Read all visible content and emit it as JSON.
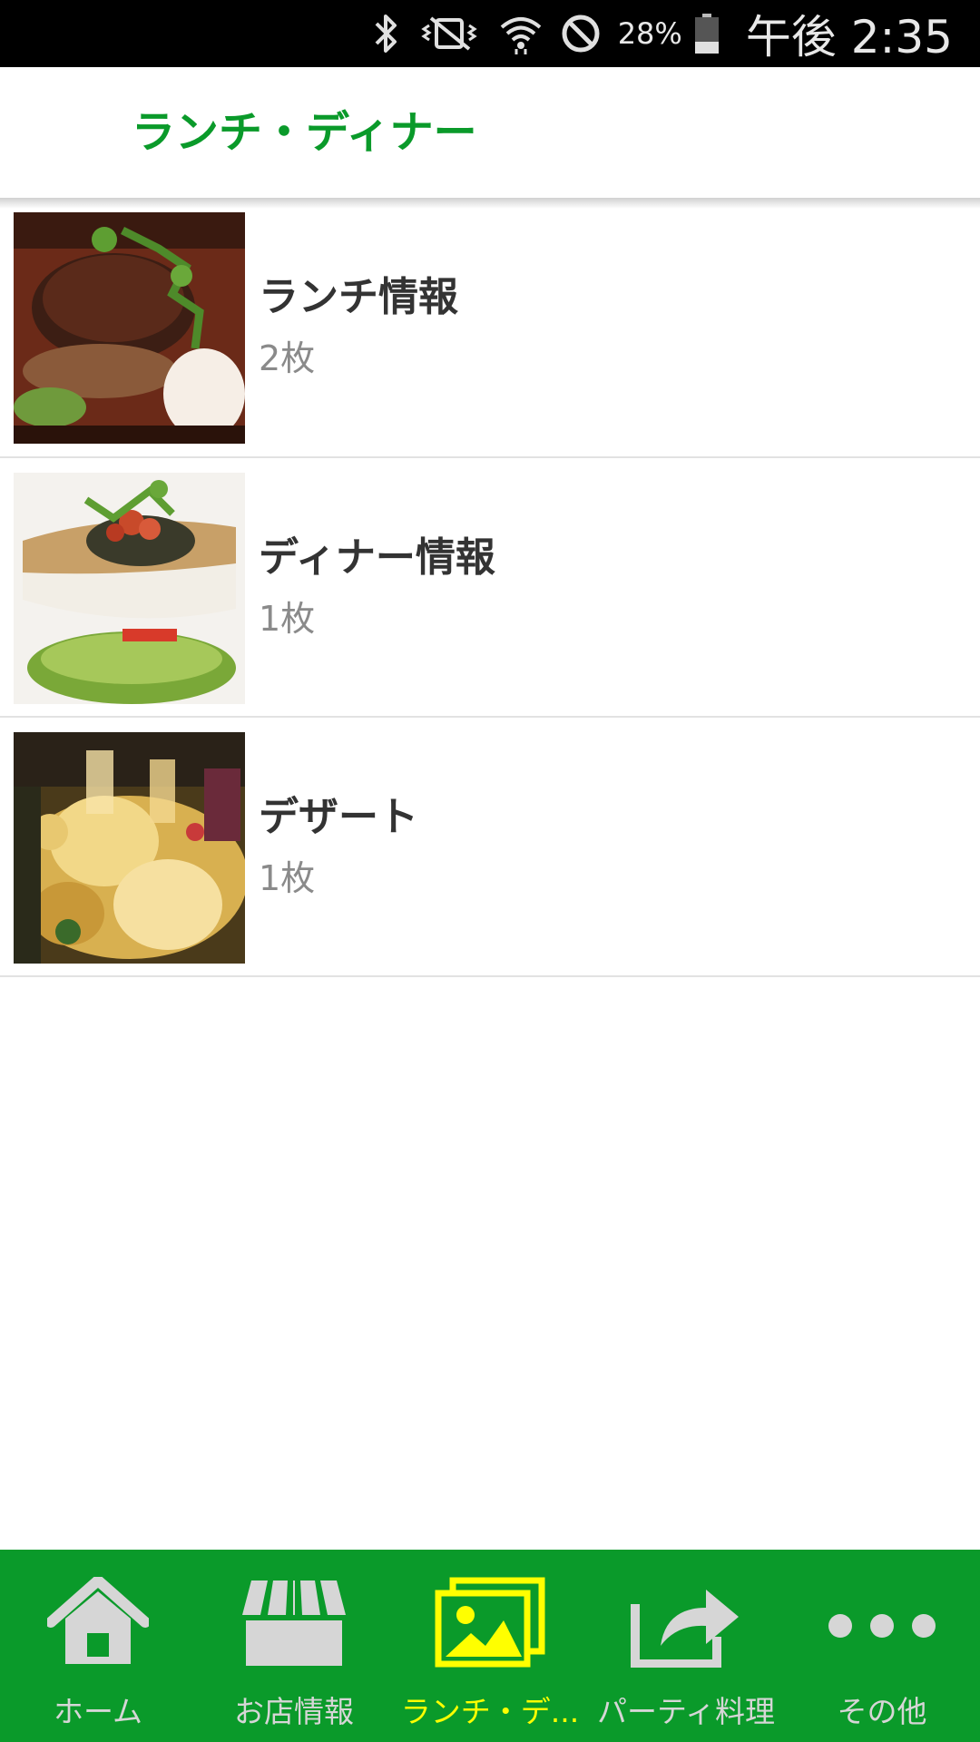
{
  "status_bar": {
    "battery": "28%",
    "time": "午後 2:35",
    "icons": [
      "bluetooth-icon",
      "vibrate-icon",
      "wifi-icon",
      "do-not-disturb-icon",
      "battery-icon"
    ]
  },
  "app_bar": {
    "title": "ランチ・ディナー"
  },
  "list": {
    "items": [
      {
        "title": "ランチ情報",
        "count": "2枚",
        "image": "hamburg-steak-photo"
      },
      {
        "title": "ディナー情報",
        "count": "1枚",
        "image": "fish-dish-photo"
      },
      {
        "title": "デザート",
        "count": "1枚",
        "image": "party-drinks-photo"
      }
    ]
  },
  "bottom_nav": {
    "tabs": [
      {
        "label": "ホーム",
        "icon": "home-icon",
        "active": false
      },
      {
        "label": "お店情報",
        "icon": "store-icon",
        "active": false
      },
      {
        "label": "ランチ・デ...",
        "icon": "gallery-icon",
        "active": true
      },
      {
        "label": "パーティ料理",
        "icon": "share-icon",
        "active": false
      },
      {
        "label": "その他",
        "icon": "more-icon",
        "active": false
      }
    ]
  },
  "colors": {
    "brand_green": "#0a9a2a",
    "active_tab": "#ffff00",
    "inactive_tab": "#d6d6d6",
    "status_bar_bg": "#000000"
  }
}
